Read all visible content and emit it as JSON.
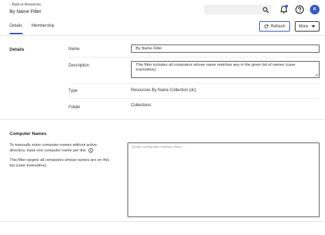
{
  "header": {
    "back_label": "Back to Resources",
    "title": "By Name Filter",
    "avatar_initial": "K"
  },
  "tabs": [
    {
      "label": "Details",
      "active": true
    },
    {
      "label": "Membership",
      "active": false
    }
  ],
  "actions": {
    "refresh_label": "Refresh",
    "more_label": "More"
  },
  "details": {
    "section_title": "Details",
    "name_label": "Name",
    "name_value": "By Name Filter",
    "description_label": "Description",
    "description_value": "This filter includes all computers whose name matches any in the given list of names (case insensitive).",
    "type_label": "Type",
    "type_value": "Resources By Name Collection (dc)",
    "folder_label": "Folder",
    "folder_value": "Collections"
  },
  "computer_names": {
    "section_title": "Computer Names",
    "help_line1": "To manually enter computer names without active directory, input one computer name per line",
    "help_line2": "This filter targets all computers whose names are on this list (case insensitive).",
    "placeholder": "Enter computer names here..."
  },
  "colors": {
    "accent": "#2d4fc7",
    "avatar_bg": "#3558c8"
  }
}
